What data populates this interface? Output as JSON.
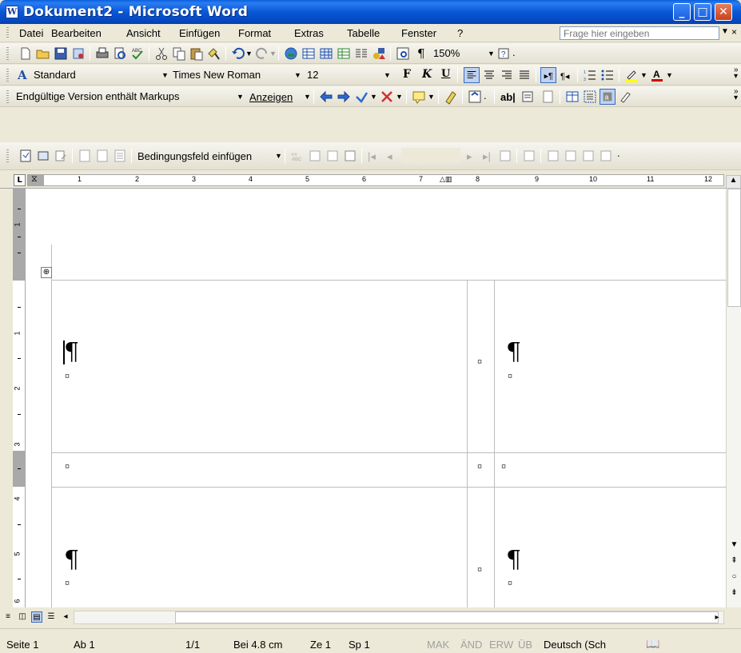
{
  "window": {
    "title": "Dokument2 - Microsoft Word",
    "app_icon": "W"
  },
  "menu": {
    "items": [
      "Datei",
      "Bearbeiten",
      "Ansicht",
      "Einfügen",
      "Format",
      "Extras",
      "Tabelle",
      "Fenster",
      "?"
    ],
    "ask_placeholder": "Frage hier eingeben"
  },
  "standard_toolbar": {
    "zoom": "150%"
  },
  "format_toolbar": {
    "style": "Standard",
    "font": "Times New Roman",
    "size": "12",
    "bold": "F",
    "italic": "K",
    "underline": "U"
  },
  "review_toolbar": {
    "markup_mode": "Endgültige Version enthält Markups",
    "show_label": "Anzeigen",
    "ab_label": "ab|"
  },
  "mailmerge_toolbar": {
    "insert_field": "Bedingungsfeld einfügen"
  },
  "ruler": {
    "numbers": [
      "1",
      "2",
      "3",
      "4",
      "5",
      "6",
      "7",
      "8",
      "9",
      "10",
      "11",
      "12"
    ]
  },
  "vruler": {
    "numbers": [
      "1",
      "1",
      "2",
      "3",
      "4",
      "5",
      "6"
    ]
  },
  "document": {
    "pilcrow": "¶",
    "cell_mark": "¤"
  },
  "status": {
    "page": "Seite 1",
    "section": "Ab 1",
    "pages": "1/1",
    "position": "Bei 4.8 cm",
    "line": "Ze 1",
    "column": "Sp 1",
    "mak": "MAK",
    "aend": "ÄND",
    "erw": "ERW",
    "ueb": "ÜB",
    "language": "Deutsch (Sch"
  },
  "colors": {
    "titlebar": "#0958d6",
    "close": "#c8421c",
    "background": "#ece9d8"
  },
  "icons": [
    "new-icon",
    "open-icon",
    "save-icon",
    "print-icon",
    "preview-icon",
    "spelling-icon",
    "cut-icon",
    "copy-icon",
    "paste-icon",
    "undo-icon",
    "redo-icon",
    "table-icon",
    "help-icon",
    "book-icon"
  ]
}
